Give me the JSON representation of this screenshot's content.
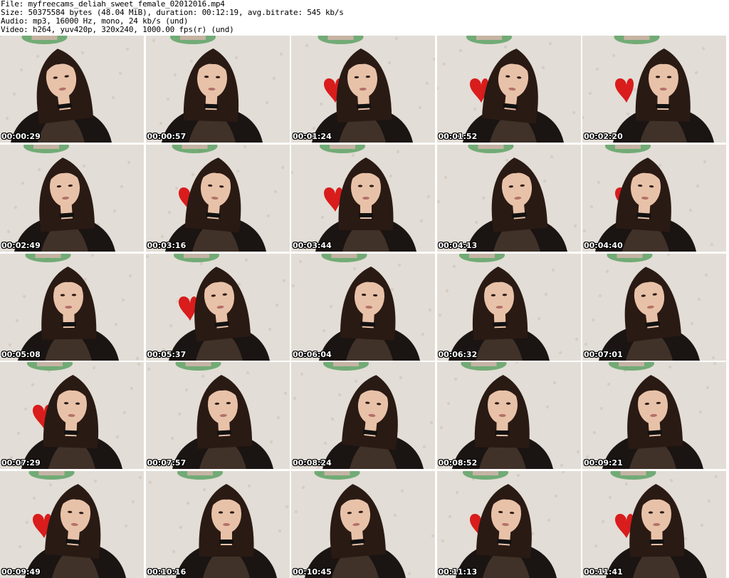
{
  "header": {
    "file_line": "File: myfreecams_deliah_sweet_female_02012016.mp4",
    "size_line": "Size: 50375584 bytes (48.04 MiB), duration: 00:12:19, avg.bitrate: 545 kb/s",
    "audio_line": "Audio: mp3, 16000 Hz, mono, 24 kb/s (und)",
    "video_line": "Video: h264, yuv420p, 320x240, 1000.00 fps(r) (und)"
  },
  "thumbnails": [
    {
      "timestamp": "00:00:29"
    },
    {
      "timestamp": "00:00:57"
    },
    {
      "timestamp": "00:01:24"
    },
    {
      "timestamp": "00:01:52"
    },
    {
      "timestamp": "00:02:20"
    },
    {
      "timestamp": "00:02:49"
    },
    {
      "timestamp": "00:03:16"
    },
    {
      "timestamp": "00:03:44"
    },
    {
      "timestamp": "00:04:13"
    },
    {
      "timestamp": "00:04:40"
    },
    {
      "timestamp": "00:05:08"
    },
    {
      "timestamp": "00:05:37"
    },
    {
      "timestamp": "00:06:04"
    },
    {
      "timestamp": "00:06:32"
    },
    {
      "timestamp": "00:07:01"
    },
    {
      "timestamp": "00:07:29"
    },
    {
      "timestamp": "00:07:57"
    },
    {
      "timestamp": "00:08:24"
    },
    {
      "timestamp": "00:08:52"
    },
    {
      "timestamp": "00:09:21"
    },
    {
      "timestamp": "00:09:49"
    },
    {
      "timestamp": "00:10:16"
    },
    {
      "timestamp": "00:10:45"
    },
    {
      "timestamp": "00:11:13"
    },
    {
      "timestamp": "00:11:41"
    }
  ],
  "colors": {
    "wall": "#e2ddd6",
    "hair": "#2a1a14",
    "skin": "#e8c2a8",
    "top": "#1a1412",
    "heart": "#d91c1c",
    "decor_green": "#4c9a55"
  }
}
